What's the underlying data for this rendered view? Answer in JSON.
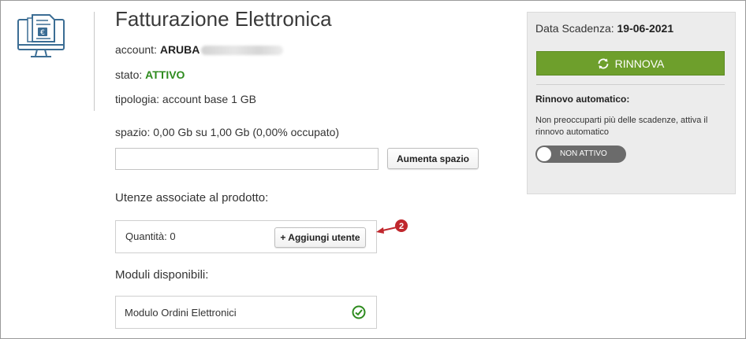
{
  "product": {
    "icon": "electronic-invoice-monitor-icon",
    "title": "Fatturazione Elettronica",
    "account_label": "account: ",
    "account_value": "ARUBA",
    "status_label": "stato: ",
    "status_value": "ATTIVO",
    "type_text": "tipologia: account base 1 GB",
    "space_text": "spazio: 0,00 Gb su 1,00 Gb (0,00% occupato)",
    "space_input_value": "",
    "increase_space_button": "Aumenta spazio"
  },
  "users": {
    "section_label": "Utenze associate al prodotto:",
    "quantity_text": "Quantità: 0",
    "add_user_button": "+ Aggiungi utente"
  },
  "callout": {
    "number": "2",
    "color": "#c0272d"
  },
  "modules": {
    "section_label": "Moduli disponibili:",
    "items": [
      {
        "name": "Modulo Ordini Elettronici",
        "icon": "check-circle-icon",
        "status_color": "#2e8b1e"
      }
    ]
  },
  "side_panel": {
    "expiry_label": "Data Scadenza: ",
    "expiry_value": "19-06-2021",
    "renew_button": "RINNOVA",
    "renew_icon": "refresh-icon",
    "renew_color": "#6e9f2c",
    "auto_renew_title": "Rinnovo automatico:",
    "auto_renew_description": "Non preoccuparti più delle scadenze, attiva il rinnovo automatico",
    "toggle_label": "NON ATTIVO",
    "toggle_state": "off"
  }
}
